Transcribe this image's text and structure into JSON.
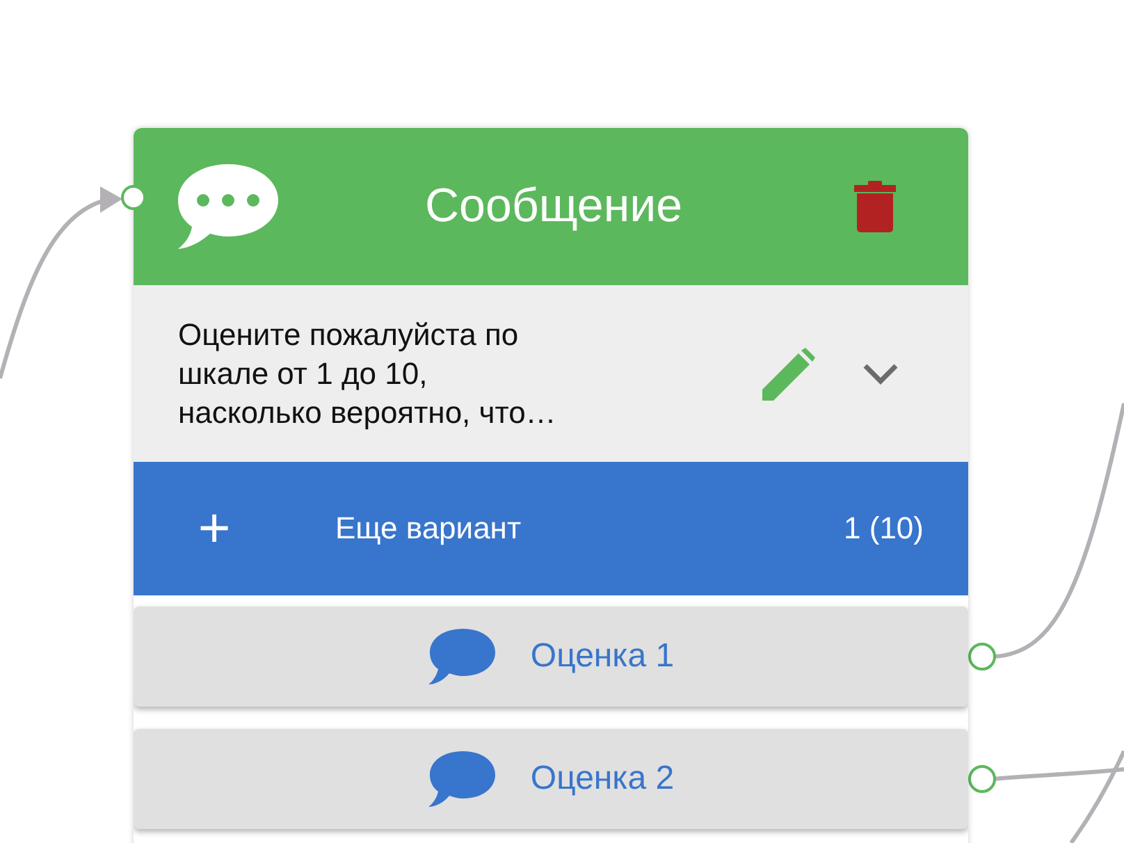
{
  "node": {
    "title": "Сообщение",
    "message": "Оцените пожалуйста по\nшкале от 1 до 10,\nнасколько вероятно, что…",
    "add_option": {
      "icon": "+",
      "label": "Еще вариант",
      "count": "1 (10)"
    },
    "options": [
      {
        "label": "Оценка 1"
      },
      {
        "label": "Оценка 2"
      }
    ]
  }
}
